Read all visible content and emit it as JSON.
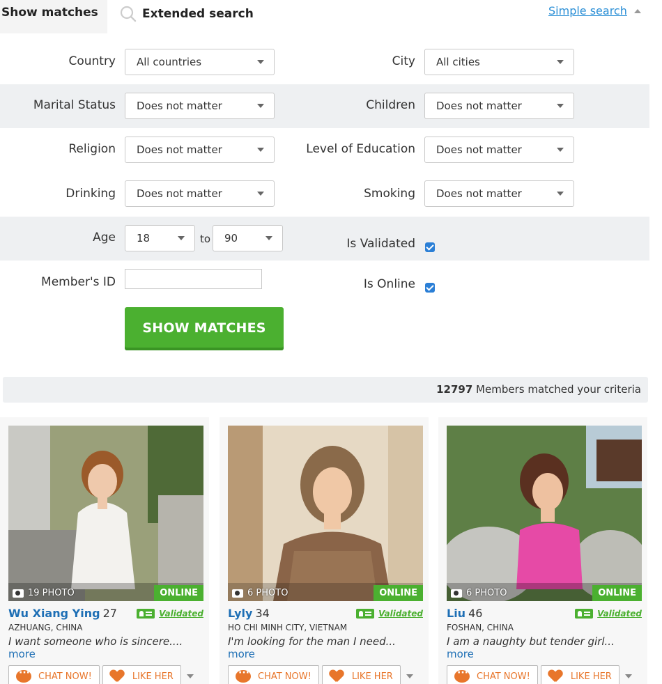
{
  "tabs": {
    "show_matches": "Show matches",
    "extended_search": "Extended search",
    "simple_search": "Simple search"
  },
  "form": {
    "country": {
      "label": "Country",
      "value": "All countries"
    },
    "city": {
      "label": "City",
      "value": "All cities"
    },
    "marital": {
      "label": "Marital Status",
      "value": "Does not matter"
    },
    "children": {
      "label": "Children",
      "value": "Does not matter"
    },
    "religion": {
      "label": "Religion",
      "value": "Does not matter"
    },
    "education": {
      "label": "Level of Education",
      "value": "Does not matter"
    },
    "drinking": {
      "label": "Drinking",
      "value": "Does not matter"
    },
    "smoking": {
      "label": "Smoking",
      "value": "Does not matter"
    },
    "age": {
      "label": "Age",
      "from": "18",
      "to_label": "to",
      "to": "90"
    },
    "validated": {
      "label": "Is Validated",
      "checked": true
    },
    "online": {
      "label": "Is Online",
      "checked": true
    },
    "member_id": {
      "label": "Member's ID",
      "value": ""
    },
    "submit": "SHOW MATCHES"
  },
  "results": {
    "count": "12797",
    "text": "Members matched your criteria"
  },
  "cards": [
    {
      "photos": "19 PHOTO",
      "online": "ONLINE",
      "name": "Wu Xiang Ying",
      "age": "27",
      "validated": "Validated",
      "location": "AZHUANG, CHINA",
      "bio": "I want someone who is sincere....",
      "more": "more",
      "chat": "CHAT NOW!",
      "like": "LIKE HER"
    },
    {
      "photos": "6 PHOTO",
      "online": "ONLINE",
      "name": "Lyly",
      "age": "34",
      "validated": "Validated",
      "location": "HO CHI MINH CITY, VIETNAM",
      "bio": "I'm looking for the man I need...",
      "more": "more",
      "chat": "CHAT NOW!",
      "like": "LIKE HER"
    },
    {
      "photos": "6 PHOTO",
      "online": "ONLINE",
      "name": "Liu",
      "age": "46",
      "validated": "Validated",
      "location": "FOSHAN, CHINA",
      "bio": "I am a naughty but tender girl...",
      "more": "more",
      "chat": "CHAT NOW!",
      "like": "LIKE HER"
    }
  ],
  "colors": {
    "accent_green": "#4bb030",
    "link_blue": "#1e6fb5",
    "action_orange": "#e8762b",
    "band_gray": "#eef0f2"
  }
}
